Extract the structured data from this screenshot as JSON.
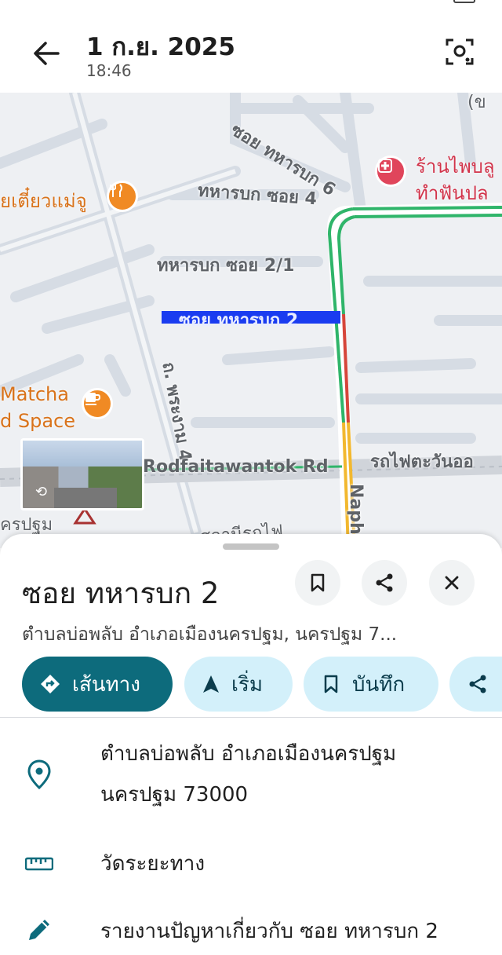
{
  "header": {
    "date": "1 ก.ย. 2025",
    "time": "18:46"
  },
  "map": {
    "labels": {
      "soi6": "ซอย ทหารบก 6",
      "soi4": "ทหารบก ซอย 4",
      "soi21": "ทหารบก ซอย 2/1",
      "soi2": "ซอย ทหารบก 2",
      "phrachan": "ถ. พระงาม 4",
      "rodfai": "Rodfaitawantok Rd",
      "rodfai_th": "รถไฟตะวันออ",
      "naph": "Naph",
      "nakhon": "ครปฐม",
      "station": "สถานีรถไฟ",
      "corner": "(ข"
    },
    "pois": {
      "noodle": "ยเตี๋ยวแม่จู",
      "matcha1": "Matcha",
      "matcha2": "d Space",
      "dental1": "ร้านไพบลู",
      "dental2": "ทำฟันปล"
    }
  },
  "sheet": {
    "title": "ซอย ทหารบก 2",
    "address_line": "ตำบลบ่อพลับ อำเภอเมืองนครปฐม, นครปฐม 7...",
    "chips": {
      "directions": "เส้นทาง",
      "start": "เริ่ม",
      "save": "บันทึก"
    },
    "address_full_1": "ตำบลบ่อพลับ อำเภอเมืองนครปฐม",
    "address_full_2": "นครปฐม 73000",
    "measure": "วัดระยะทาง",
    "report": "รายงานปัญหาเกี่ยวกับ ซอย ทหารบก 2"
  },
  "colors": {
    "accent": "#0d6b7c",
    "chip_bg": "#d3f0fa",
    "route_highlight": "#1a3cf0",
    "traffic_green": "#2fb56a",
    "traffic_red": "#d6453a",
    "traffic_yellow": "#f2b82f"
  }
}
